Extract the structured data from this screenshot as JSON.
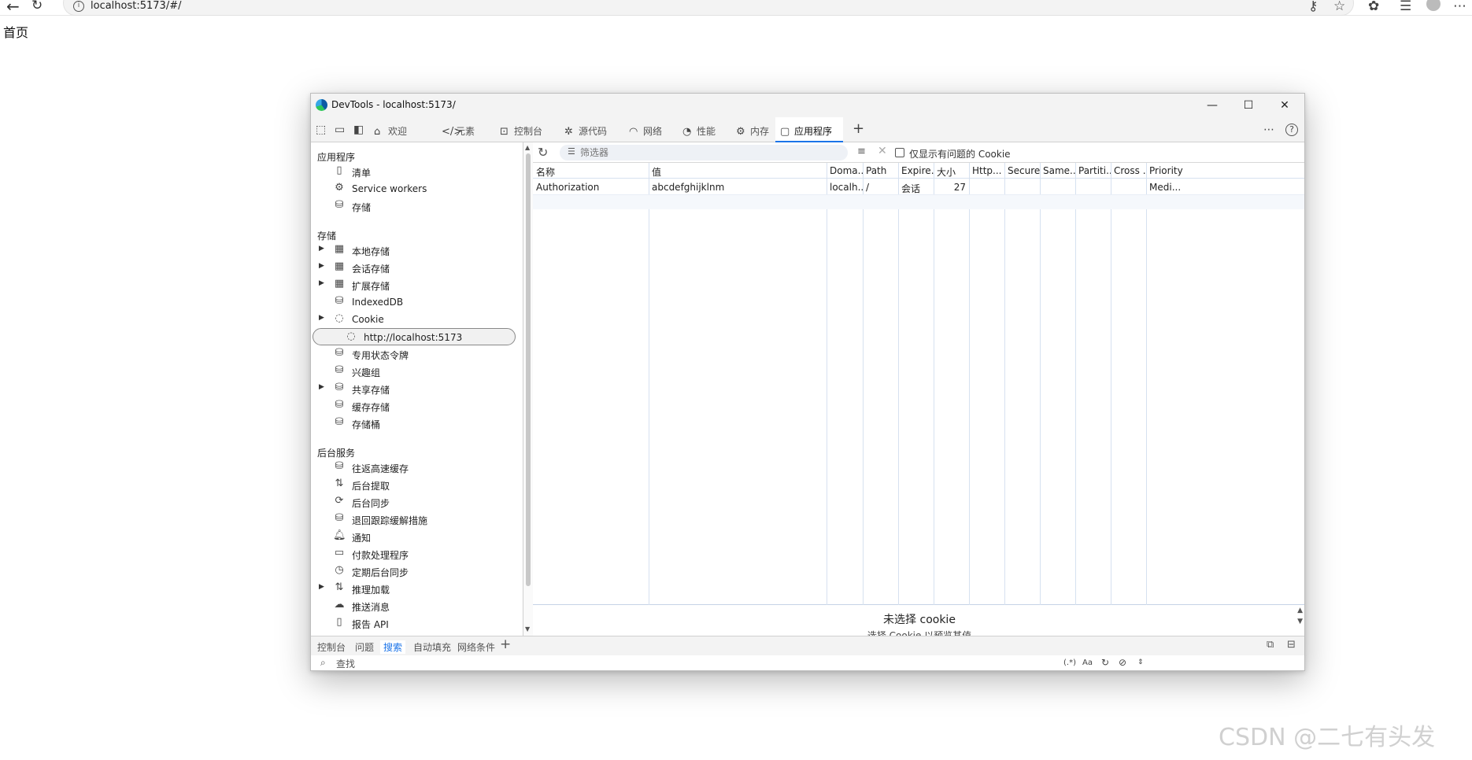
{
  "browser": {
    "url": "localhost:5173/#/",
    "back_icon": "back-arrow-icon",
    "reload_icon": "reload-icon"
  },
  "page": {
    "text": "首页"
  },
  "devtools": {
    "window_title": "DevTools - localhost:5173/",
    "tabs": [
      {
        "label": "欢迎",
        "icon": "home-icon"
      },
      {
        "label": "元素",
        "icon": "code-icon"
      },
      {
        "label": "控制台",
        "icon": "console-icon"
      },
      {
        "label": "源代码",
        "icon": "bug-icon"
      },
      {
        "label": "网络",
        "icon": "wifi-icon"
      },
      {
        "label": "性能",
        "icon": "gauge-icon"
      },
      {
        "label": "内存",
        "icon": "gear-icon"
      },
      {
        "label": "应用程序",
        "icon": "app-icon",
        "active": true
      }
    ],
    "sidebar": {
      "app_header": "应用程序",
      "app_items": [
        {
          "label": "清单",
          "icon": "document-icon"
        },
        {
          "label": "Service workers",
          "icon": "gear-document-icon"
        },
        {
          "label": "存储",
          "icon": "database-icon"
        }
      ],
      "storage_header": "存储",
      "storage_items": [
        {
          "label": "本地存储",
          "icon": "grid-icon",
          "expandable": true
        },
        {
          "label": "会话存储",
          "icon": "grid-icon",
          "expandable": true
        },
        {
          "label": "扩展存储",
          "icon": "grid-icon",
          "expandable": true
        },
        {
          "label": "IndexedDB",
          "icon": "database-icon"
        },
        {
          "label": "Cookie",
          "icon": "cookie-icon",
          "expandable": true
        },
        {
          "label": "http://localhost:5173",
          "icon": "cookie-icon",
          "sub": true,
          "selected": true
        },
        {
          "label": "专用状态令牌",
          "icon": "database-icon"
        },
        {
          "label": "兴趣组",
          "icon": "database-icon"
        },
        {
          "label": "共享存储",
          "icon": "database-icon",
          "expandable": true
        },
        {
          "label": "缓存存储",
          "icon": "database-icon"
        },
        {
          "label": "存储桶",
          "icon": "database-icon"
        }
      ],
      "bg_header": "后台服务",
      "bg_items": [
        {
          "label": "往返高速缓存",
          "icon": "database-icon"
        },
        {
          "label": "后台提取",
          "icon": "updown-icon"
        },
        {
          "label": "后台同步",
          "icon": "sync-icon"
        },
        {
          "label": "退回跟踪缓解措施",
          "icon": "database-icon"
        },
        {
          "label": "通知",
          "icon": "bell-icon"
        },
        {
          "label": "付款处理程序",
          "icon": "card-icon"
        },
        {
          "label": "定期后台同步",
          "icon": "clock-icon"
        },
        {
          "label": "推理加载",
          "icon": "updown-icon",
          "expandable": true
        },
        {
          "label": "推送消息",
          "icon": "cloud-icon"
        },
        {
          "label": "报告 API",
          "icon": "document-icon"
        }
      ]
    },
    "toolbar": {
      "filter_placeholder": "筛选器",
      "checkbox_label": "仅显示有问题的 Cookie"
    },
    "table": {
      "headers": [
        "名称",
        "值",
        "Doma...",
        "Path",
        "Expire...",
        "大小",
        "Http...",
        "Secure",
        "Same...",
        "Partiti...",
        "Cross ...",
        "Priority"
      ],
      "rows": [
        [
          "Authorization",
          "abcdefghijklnm",
          "localh...",
          "/",
          "会话",
          "27",
          "",
          "",
          "",
          "",
          "",
          "Medi..."
        ]
      ]
    },
    "preview": {
      "message": "未选择 cookie",
      "hint": "选择 Cookie 以预览其值"
    },
    "drawer": {
      "tabs": [
        "控制台",
        "问题",
        "搜索",
        "自动填充",
        "网络条件"
      ],
      "active_tab": "搜索",
      "search_placeholder": "查找",
      "regex_label": "(.*)",
      "case_label": "Aa"
    }
  },
  "watermark": "CSDN @二七有头发"
}
